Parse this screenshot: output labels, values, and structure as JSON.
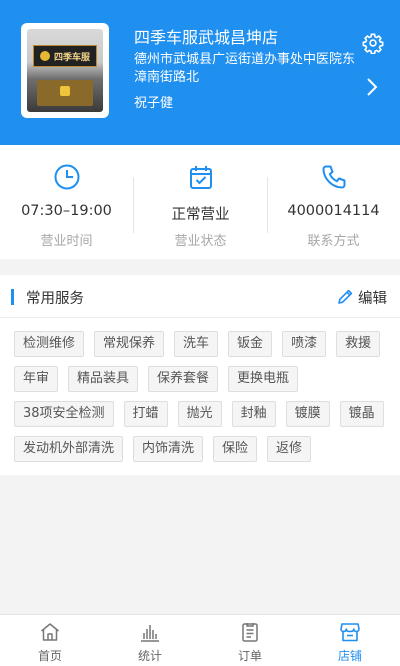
{
  "store": {
    "name": "四季车服武城昌坤店",
    "address": "德州市武城县广运街道办事处中医院东漳南街路北",
    "contact_person": "祝子健",
    "photo_sign_text": "四季车服"
  },
  "info": {
    "hours": {
      "value": "07:30–19:00",
      "label": "营业时间",
      "icon": "clock-icon"
    },
    "status": {
      "value": "正常营业",
      "label": "营业状态",
      "icon": "calendar-check-icon"
    },
    "phone": {
      "value": "4000014114",
      "label": "联系方式",
      "icon": "phone-icon"
    }
  },
  "services": {
    "title": "常用服务",
    "edit_label": "编辑",
    "tags": [
      "检测维修",
      "常规保养",
      "洗车",
      "钣金",
      "喷漆",
      "救援",
      "年审",
      "精品装具",
      "保养套餐",
      "更换电瓶",
      "38项安全检测",
      "打蜡",
      "抛光",
      "封釉",
      "镀膜",
      "镀晶",
      "发动机外部清洗",
      "内饰清洗",
      "保险",
      "返修"
    ]
  },
  "tabbar": {
    "items": [
      {
        "label": "首页",
        "icon": "home-icon"
      },
      {
        "label": "统计",
        "icon": "stats-icon"
      },
      {
        "label": "订单",
        "icon": "order-icon"
      },
      {
        "label": "店铺",
        "icon": "store-icon"
      }
    ],
    "active_index": 3
  },
  "colors": {
    "primary": "#1f8ff0",
    "background": "#f3f3f3",
    "muted_text": "#a7a7a7"
  }
}
